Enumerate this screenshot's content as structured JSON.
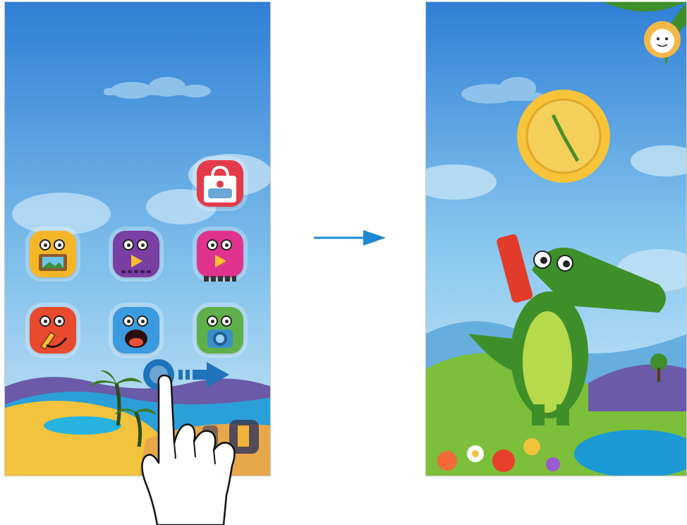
{
  "left_screen": {
    "home_apps": [
      {
        "name": "gallery-app-icon",
        "color": "#f4b626",
        "icon": "picture-frame-icon"
      },
      {
        "name": "video-app-icon",
        "color": "#7a3fa3",
        "icon": "play-icon"
      },
      {
        "name": "player-app-icon",
        "color": "#e0338d",
        "icon": "play-icon"
      },
      {
        "name": "drawing-app-icon",
        "color": "#e84a2e",
        "icon": "pencil-icon"
      },
      {
        "name": "voice-app-icon",
        "color": "#3b9be0",
        "icon": "mouth-icon"
      },
      {
        "name": "camera-app-icon",
        "color": "#5fb04b",
        "icon": "camera-lens-icon"
      }
    ],
    "store_app": {
      "color": "#e53a4a",
      "icon": "shopping-bag-icon"
    },
    "exit_icon": "door-exit-icon",
    "gesture": "swipe-right"
  },
  "transition_arrow_color": "#1e88d0",
  "right_screen": {
    "profile_icon": "child-face-icon",
    "clock_icon": "sun-clock-icon",
    "mascot": "crocodile-character"
  },
  "colors": {
    "sky_top": "#2f7fd6",
    "sky_bottom": "#bfe2f5",
    "sand": "#f2c33c",
    "grass": "#7cbf3a",
    "water": "#1c9ad6",
    "swipe_blue": "#1f74b9"
  }
}
